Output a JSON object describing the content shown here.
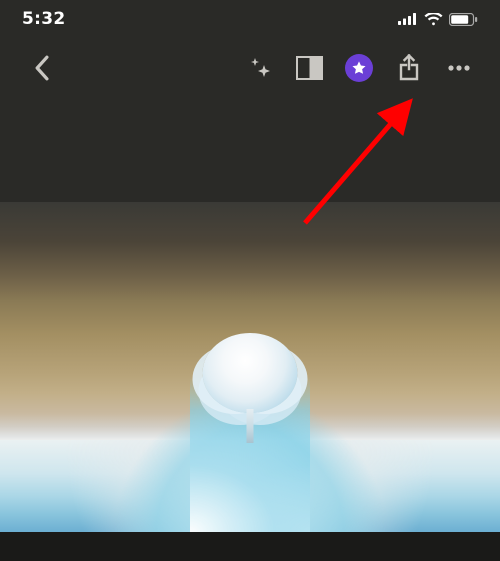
{
  "statusbar": {
    "time": "5:32",
    "signal_bars": 4,
    "wifi": true,
    "battery_pct": 80
  },
  "toolbar": {
    "back": {
      "name": "back-button"
    },
    "effects": {
      "name": "effects-button"
    },
    "crop": {
      "name": "crop-rotate-button"
    },
    "favorite": {
      "name": "favorite-button",
      "active": true,
      "accent": "#6b3fd6"
    },
    "share": {
      "name": "share-button"
    },
    "more": {
      "name": "more-button"
    }
  },
  "annotation": {
    "arrow_target": "share-button",
    "arrow_color": "#ff0000"
  }
}
